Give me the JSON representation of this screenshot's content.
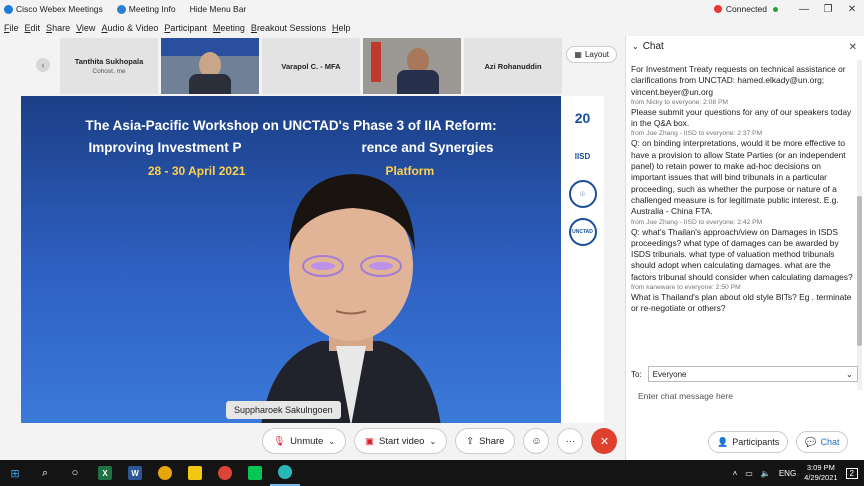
{
  "titlebar": {
    "app_name": "Cisco Webex Meetings",
    "meeting_info": "Meeting Info",
    "hide_menu": "Hide Menu Bar",
    "status": "Connected",
    "status_color": "#2a9d3a"
  },
  "menu": [
    "File",
    "Edit",
    "Share",
    "View",
    "Audio & Video",
    "Participant",
    "Meeting",
    "Breakout Sessions",
    "Help"
  ],
  "thumbnails": [
    {
      "name": "Tanthita Sukhopala",
      "sub": "Cohost, me"
    },
    {
      "name": "",
      "sub": ""
    },
    {
      "name": "Varapol C. - MFA",
      "sub": ""
    },
    {
      "name": "",
      "sub": ""
    },
    {
      "name": "Azi Rohanuddin",
      "sub": ""
    }
  ],
  "layout_label": "Layout",
  "banner": {
    "line1": "The Asia-Pacific Workshop on UNCTAD's Phase 3 of IIA Reform:",
    "line2": "Improving Investment P",
    "line2b": "rence and Synergies",
    "line3": "28 - 30 April 2021",
    "line3b": "Platform"
  },
  "logos": [
    "20",
    "IISD",
    "",
    "UNCTAD"
  ],
  "speaker_name": "Suppharoek Sakulngoen",
  "controls": {
    "mute": "Unmute",
    "video": "Start video",
    "share": "Share"
  },
  "chat": {
    "title": "Chat",
    "messages": [
      {
        "meta": "",
        "text": "For Investment Treaty requests on technical assistance or clarifications from UNCTAD: hamed.elkady@un.org; vincent.beyer@un.org"
      },
      {
        "meta": "from Nicky to everyone:    2:08 PM",
        "text": "Please submit your questions for any of our speakers today in the Q&A box."
      },
      {
        "meta": "from Joe Zhang - IISD to everyone:    2:37 PM",
        "text": "Q: on binding interpretations, would it be more effective to have a provision to allow State Parties (or an independent panel) to retain power to make ad-hoc decisions on important issues that will bind tribunals in a particular proceeding, such as whether the purpose or nature of a challenged measure is for legitimate public interest. E.g. Australia - China FTA."
      },
      {
        "meta": "from Joe Zhang - IISD to everyone:    2:42 PM",
        "text": "Q: what's Thailan's approach/view on Damages in ISDS proceedings? what type of damages can be awarded by ISDS tribunals. what type of valuation method tribunals should adopt when calculating damages. what are the factors tribunal should consider when calculating damages?"
      },
      {
        "meta": "from kaneware to everyone:    2:50 PM",
        "text": "What is Thailand's plan about old style BITs? Eg . terminate or re-negotiate or others?"
      }
    ],
    "to_label": "To:",
    "to_value": "Everyone",
    "input_placeholder": "Enter chat message here",
    "participants_btn": "Participants",
    "chat_btn": "Chat"
  },
  "taskbar": {
    "lang": "ENG",
    "time": "3:09 PM",
    "date": "4/29/2021",
    "notif": "2"
  }
}
